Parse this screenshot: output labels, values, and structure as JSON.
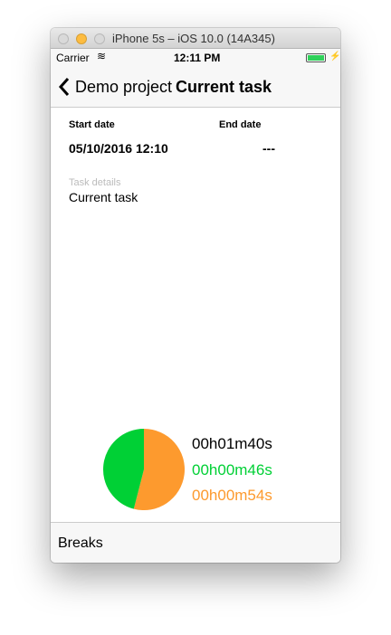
{
  "window": {
    "title": "iPhone 5s – iOS 10.0 (14A345)"
  },
  "status_bar": {
    "carrier": "Carrier",
    "time": "12:11 PM"
  },
  "nav": {
    "back_label": "Demo project",
    "title": "Current task"
  },
  "dates": {
    "start_label": "Start date",
    "end_label": "End date",
    "start_value": "05/10/2016 12:10",
    "end_value": "---"
  },
  "details": {
    "label": "Task details",
    "value": "Current task"
  },
  "chart_data": {
    "type": "pie",
    "slices": [
      {
        "name": "orange",
        "value": 54,
        "color": "#fd9a2e"
      },
      {
        "name": "green",
        "value": 46,
        "color": "#00d035"
      }
    ],
    "total_label": "00h01m40s",
    "green_label": "00h00m46s",
    "orange_label": "00h00m54s"
  },
  "toolbar": {
    "breaks_label": "Breaks"
  }
}
